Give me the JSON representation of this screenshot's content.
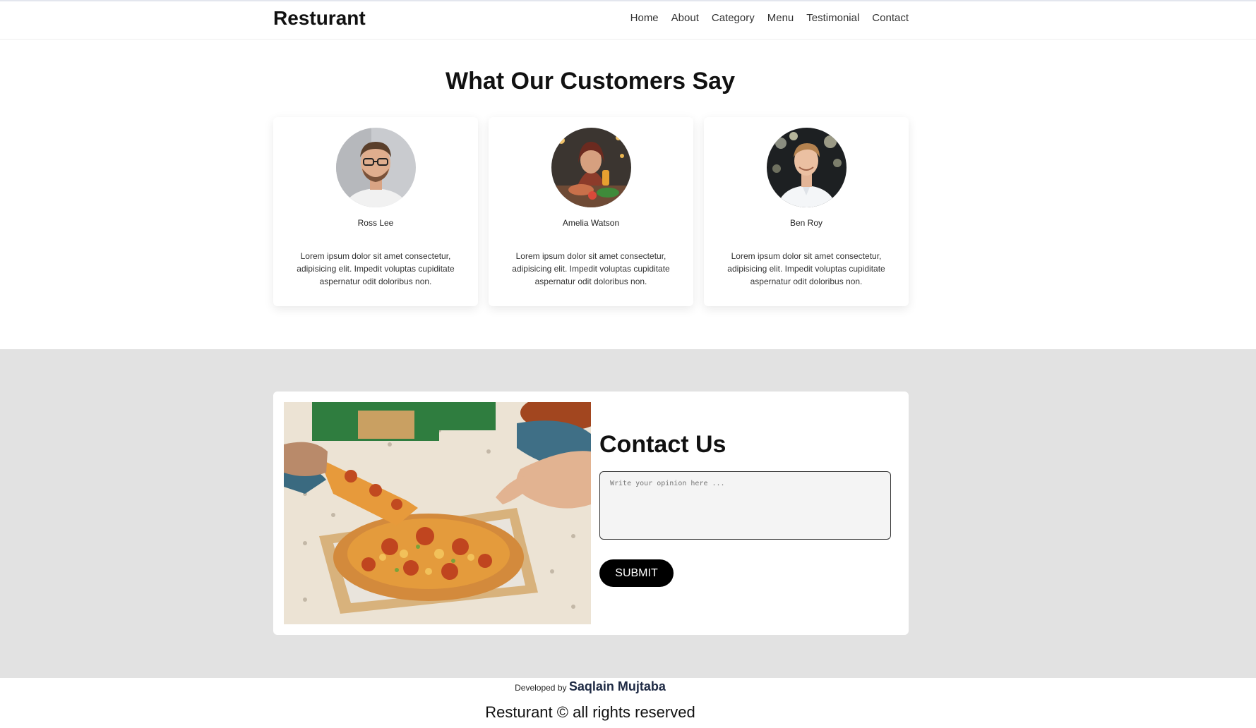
{
  "header": {
    "brand": "Resturant",
    "nav": [
      {
        "label": "Home"
      },
      {
        "label": "About"
      },
      {
        "label": "Category"
      },
      {
        "label": "Menu"
      },
      {
        "label": "Testimonial"
      },
      {
        "label": "Contact"
      }
    ]
  },
  "testimonials": {
    "title": "What Our Customers Say",
    "items": [
      {
        "name": "Ross Lee",
        "text": "Lorem ipsum dolor sit amet consectetur, adipisicing elit. Impedit voluptas cupiditate aspernatur odit doloribus non."
      },
      {
        "name": "Amelia Watson",
        "text": "Lorem ipsum dolor sit amet consectetur, adipisicing elit. Impedit voluptas cupiditate aspernatur odit doloribus non."
      },
      {
        "name": "Ben Roy",
        "text": "Lorem ipsum dolor sit amet consectetur, adipisicing elit. Impedit voluptas cupiditate aspernatur odit doloribus non."
      }
    ]
  },
  "contact": {
    "title": "Contact Us",
    "placeholder": "Write your opinion here ...",
    "submit_label": "SUBMIT"
  },
  "footer": {
    "developed_by": "Developed by",
    "author": "Saqlain Mujtaba",
    "rights": "Resturant © all rights reserved"
  }
}
